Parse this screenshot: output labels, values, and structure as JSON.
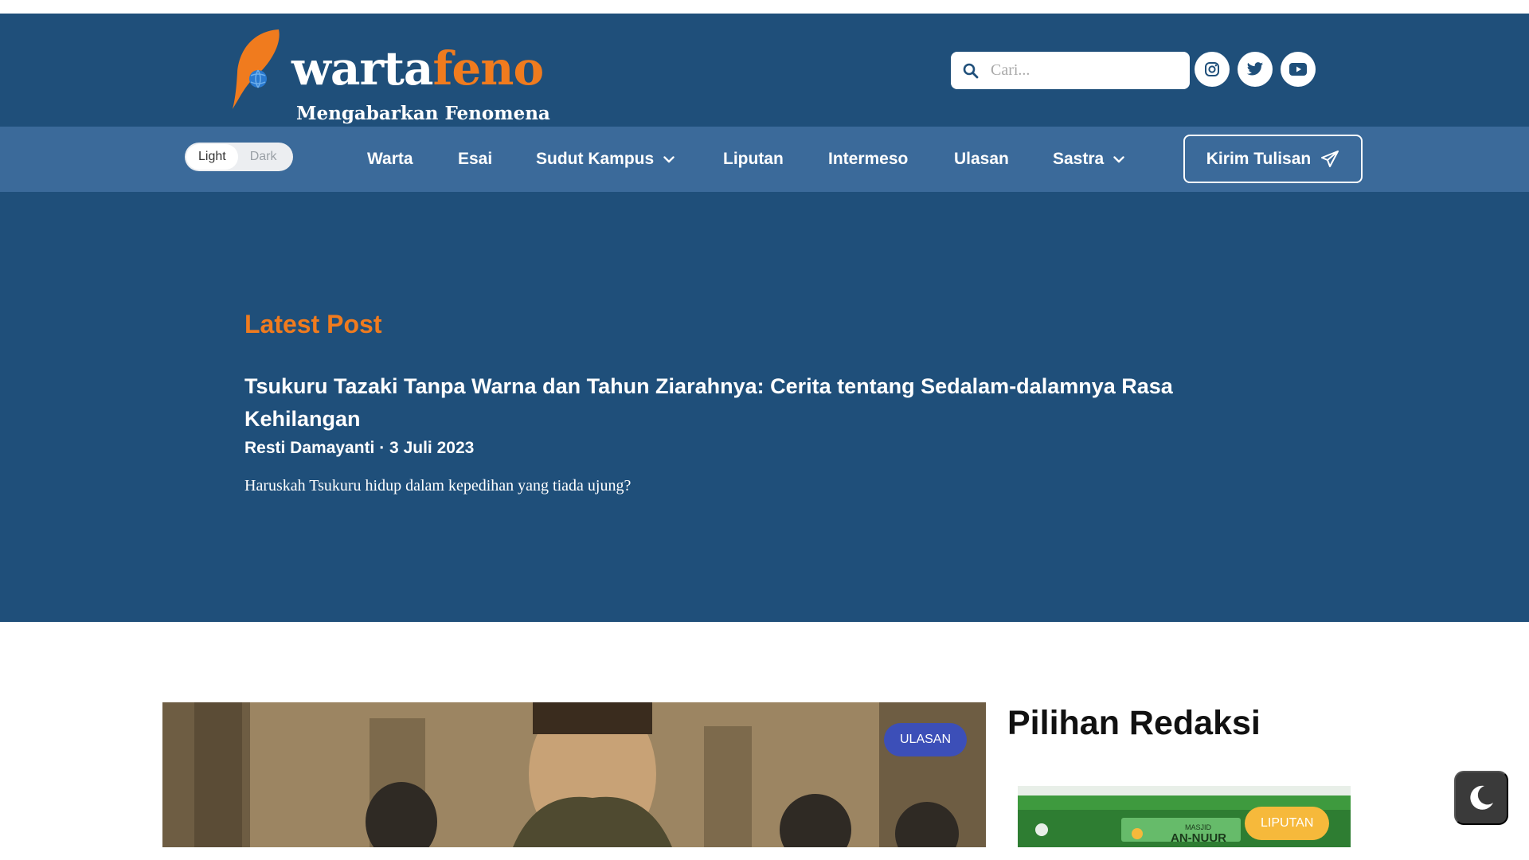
{
  "header": {
    "logo_part1": "warta",
    "logo_part2": "feno",
    "tagline": "Mengabarkan Fenomena",
    "search_placeholder": "Cari...",
    "social": [
      "instagram-icon",
      "twitter-icon",
      "youtube-icon"
    ]
  },
  "theme_toggle": {
    "light": "Light",
    "dark": "Dark",
    "selected": "Light"
  },
  "nav": {
    "items": [
      {
        "label": "Warta",
        "dropdown": false
      },
      {
        "label": "Esai",
        "dropdown": false
      },
      {
        "label": "Sudut Kampus",
        "dropdown": true
      },
      {
        "label": "Liputan",
        "dropdown": false
      },
      {
        "label": "Intermeso",
        "dropdown": false
      },
      {
        "label": "Ulasan",
        "dropdown": false
      },
      {
        "label": "Sastra",
        "dropdown": true
      }
    ],
    "cta_label": "Kirim Tulisan"
  },
  "hero": {
    "heading": "Latest Post",
    "title": "Tsukuru Tazaki Tanpa Warna dan Tahun Ziarahnya: Cerita tentang Sedalam-dalamnya Rasa Kehilangan",
    "meta": "Resti Damayanti · 3 Juli 2023",
    "excerpt": "Haruskah Tsukuru hidup dalam kepedihan yang tiada ujung?"
  },
  "main_post": {
    "badge": "ULASAN"
  },
  "sidebar": {
    "title": "Pilihan Redaksi",
    "post_badge": "LIPUTAN",
    "post_image_text_1": "MASJID",
    "post_image_text_2": "AN-NUUR"
  },
  "colors": {
    "header_bg": "#1f4f7a",
    "nav_bg": "#3b6a9a",
    "accent_orange": "#f07b1e",
    "badge_blue": "#3c4fb8",
    "badge_yellow": "#f6b93b"
  }
}
